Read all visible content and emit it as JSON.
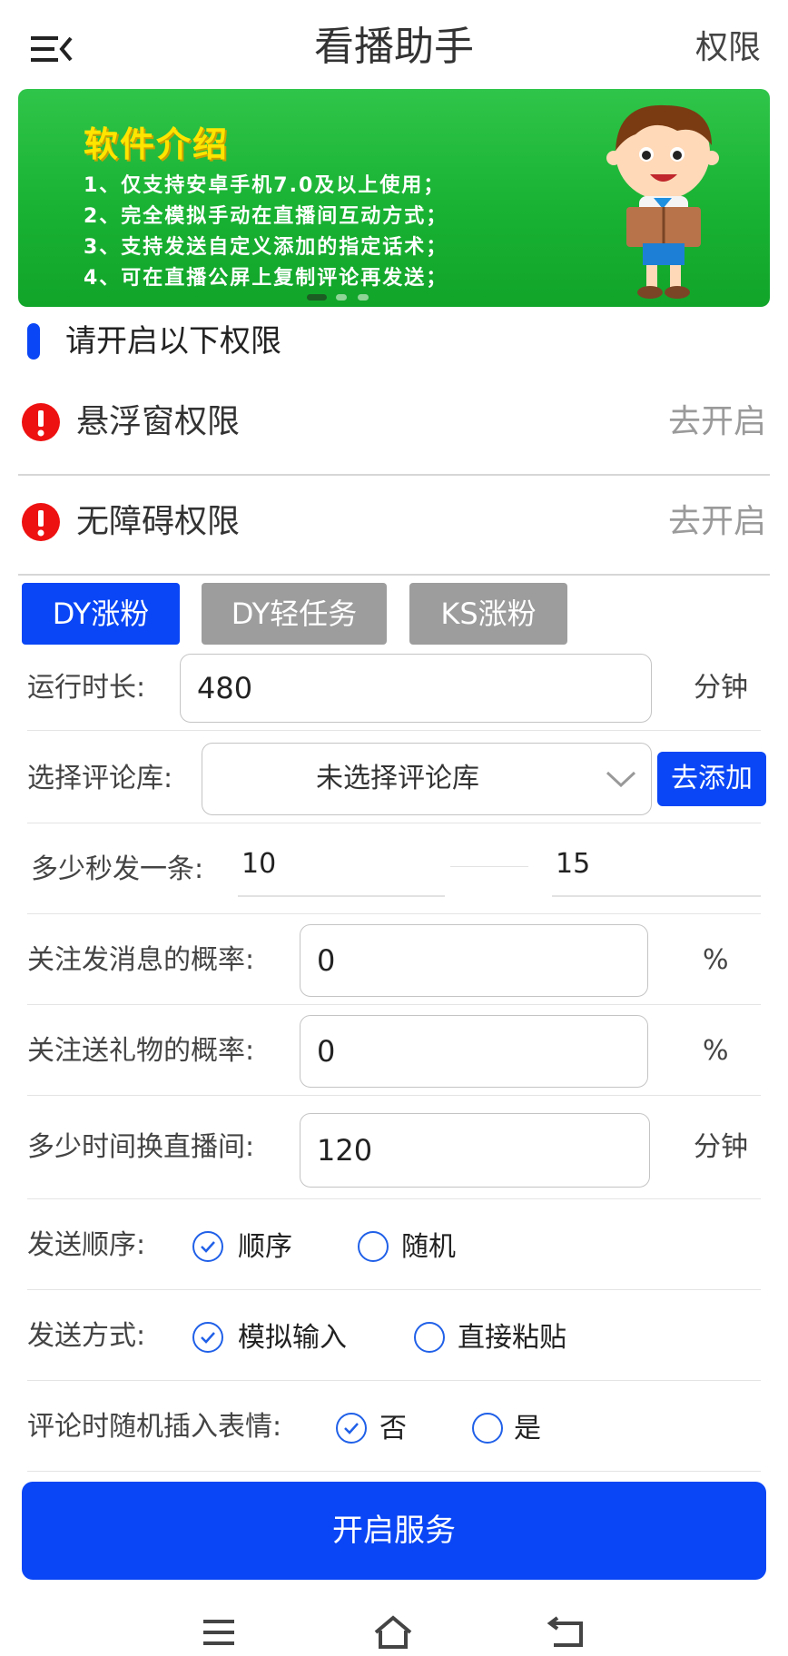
{
  "header": {
    "title": "看播助手",
    "permission_link": "权限"
  },
  "banner": {
    "title": "软件介绍",
    "lines": [
      "1、仅支持安卓手机7.0及以上使用；",
      "2、完全模拟手动在直播间互动方式；",
      "3、支持发送自定义添加的指定话术；",
      "4、可在直播公屏上复制评论再发送；"
    ],
    "active_slide": 1,
    "slide_count": 3
  },
  "permissions": {
    "section_title": "请开启以下权限",
    "items": [
      {
        "label": "悬浮窗权限",
        "action": "去开启"
      },
      {
        "label": "无障碍权限",
        "action": "去开启"
      }
    ]
  },
  "tabs": [
    {
      "label": "DY涨粉",
      "active": true
    },
    {
      "label": "DY轻任务",
      "active": false
    },
    {
      "label": "KS涨粉",
      "active": false
    }
  ],
  "form": {
    "run_duration": {
      "label": "运行时长:",
      "value": "480",
      "unit": "分钟"
    },
    "comment_lib": {
      "label": "选择评论库:",
      "value": "未选择评论库",
      "add_button": "去添加"
    },
    "interval": {
      "label": "多少秒发一条:",
      "min": "10",
      "max": "15"
    },
    "follow_msg": {
      "label": "关注发消息的概率:",
      "value": "0",
      "unit": "%"
    },
    "follow_gift": {
      "label": "关注送礼物的概率:",
      "value": "0",
      "unit": "%"
    },
    "switch_room": {
      "label": "多少时间换直播间:",
      "value": "120",
      "unit": "分钟"
    },
    "send_order": {
      "label": "发送顺序:",
      "options": [
        "顺序",
        "随机"
      ],
      "selected": "顺序"
    },
    "send_mode": {
      "label": "发送方式:",
      "options": [
        "模拟输入",
        "直接粘贴"
      ],
      "selected": "模拟输入"
    },
    "emoji": {
      "label": "评论时随机插入表情:",
      "options": [
        "否",
        "是"
      ],
      "selected": "否"
    }
  },
  "start_button": "开启服务",
  "colors": {
    "primary": "#0a46f5",
    "warning": "#ee1111",
    "banner_green": "#19b233",
    "tab_inactive": "#9d9d9d"
  }
}
